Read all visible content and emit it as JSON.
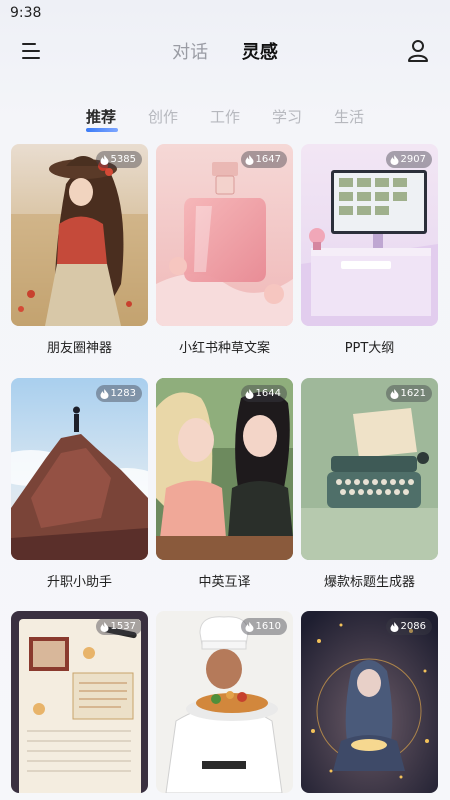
{
  "status_bar": {
    "time": "9:38"
  },
  "header": {
    "tabs": [
      {
        "label": "对话",
        "active": false
      },
      {
        "label": "灵感",
        "active": true
      }
    ]
  },
  "categories": [
    {
      "label": "推荐",
      "active": true
    },
    {
      "label": "创作",
      "active": false
    },
    {
      "label": "工作",
      "active": false
    },
    {
      "label": "学习",
      "active": false
    },
    {
      "label": "生活",
      "active": false
    }
  ],
  "cards": [
    {
      "title": "朋友圈神器",
      "count": "5385",
      "image": "girl-in-field"
    },
    {
      "title": "小红书种草文案",
      "count": "1647",
      "image": "perfume-bottle"
    },
    {
      "title": "PPT大纲",
      "count": "2907",
      "image": "desk-monitor"
    },
    {
      "title": "升职小助手",
      "count": "1283",
      "image": "man-on-mountain"
    },
    {
      "title": "中英互译",
      "count": "1644",
      "image": "two-girls"
    },
    {
      "title": "爆款标题生成器",
      "count": "1621",
      "image": "typewriter"
    },
    {
      "title": "",
      "count": "1537",
      "image": "notebook"
    },
    {
      "title": "",
      "count": "1610",
      "image": "chef"
    },
    {
      "title": "",
      "count": "2086",
      "image": "girl-reading-stars"
    }
  ],
  "colors": {
    "accent": "#3b7bf6",
    "inactive_tab": "#9a9ca4"
  }
}
